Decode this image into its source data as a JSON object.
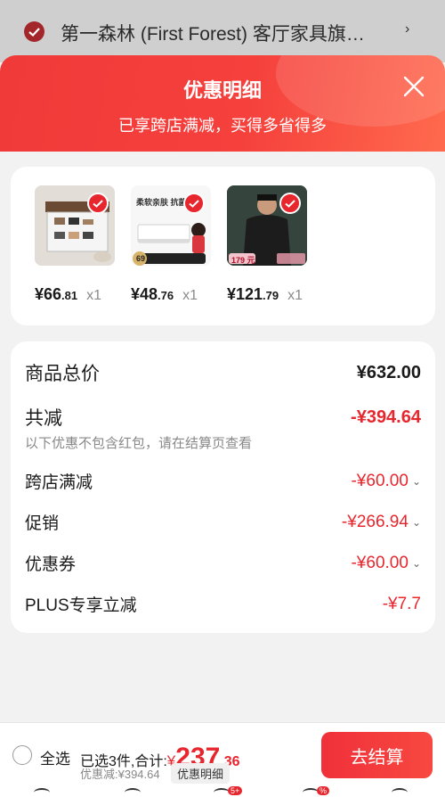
{
  "background": {
    "shop_name": "第一森林 (First Forest) 客厅家具旗…"
  },
  "sheet": {
    "title": "优惠明细",
    "subtitle": "已享跨店满减，买得多省得多"
  },
  "products": [
    {
      "price_int": "¥66",
      "price_dec": ".81",
      "qty": "x1"
    },
    {
      "price_int": "¥48",
      "price_dec": ".76",
      "qty": "x1",
      "img_tag": "柔软亲肤 抗菌",
      "img_badge": "69"
    },
    {
      "price_int": "¥121",
      "price_dec": ".79",
      "qty": "x1",
      "img_badge": "179 元"
    }
  ],
  "summary": {
    "total_label": "商品总价",
    "total_value": "¥632.00",
    "reduce_label": "共减",
    "reduce_value": "-¥394.64",
    "note": "以下优惠不包含红包，请在结算页查看",
    "items": [
      {
        "label": "跨店满减",
        "value": "-¥60.00",
        "expandable": true
      },
      {
        "label": "促销",
        "value": "-¥266.94",
        "expandable": true
      },
      {
        "label": "优惠券",
        "value": "-¥60.00",
        "expandable": true
      },
      {
        "label": "PLUS专享立减",
        "value": "-¥7.7",
        "expandable": false
      }
    ]
  },
  "bottom": {
    "select_all": "全选",
    "selected_text": "已选3件,合计:",
    "total_currency": "¥",
    "total_int": "237",
    "total_dec": ".36",
    "discount_text": "优惠减:¥394.64",
    "detail_chip": "优惠明细",
    "checkout": "去结算"
  },
  "tabbar": {
    "badges": [
      "5+",
      "%"
    ]
  },
  "colors": {
    "accent": "#e8262e",
    "header_gradient_start": "#f03a3a",
    "header_gradient_end": "#ff6a4e"
  }
}
